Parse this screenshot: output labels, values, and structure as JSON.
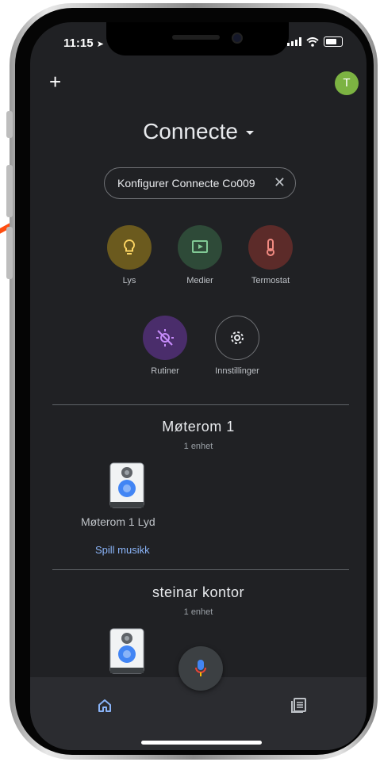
{
  "status_bar": {
    "time": "11:15"
  },
  "header": {
    "add_icon": "+",
    "avatar_initial": "T",
    "home_name": "Connecte"
  },
  "setup_chip": {
    "label": "Konfigurer Connecte Co009",
    "close": "✕"
  },
  "actions": [
    {
      "label": "Lys",
      "icon": "lightbulb-icon",
      "color": "#6b5a1e",
      "icon_color": "#fdd663"
    },
    {
      "label": "Medier",
      "icon": "media-icon",
      "color": "#2e4a38",
      "icon_color": "#81c995"
    },
    {
      "label": "Termostat",
      "icon": "thermometer-icon",
      "color": "#5c2b29",
      "icon_color": "#f28b82"
    },
    {
      "label": "Rutiner",
      "icon": "routines-icon",
      "color": "#4a2d6b",
      "icon_color": "#c58af9"
    },
    {
      "label": "Innstillinger",
      "icon": "gear-icon",
      "color": "#202124",
      "icon_color": "#e8eaed"
    }
  ],
  "rooms": [
    {
      "name": "Møterom 1",
      "count": "1 enhet",
      "device_name": "Møterom 1 Lyd",
      "action_link": "Spill musikk"
    },
    {
      "name": "steinar kontor",
      "count": "1 enhet"
    }
  ],
  "bottom_nav": {
    "home_icon": "home-icon",
    "feed_icon": "feed-icon"
  },
  "accent_colors": {
    "arrow": "#ff4d0f",
    "link": "#8ab4f8",
    "nav_active": "#8ab4f8"
  }
}
